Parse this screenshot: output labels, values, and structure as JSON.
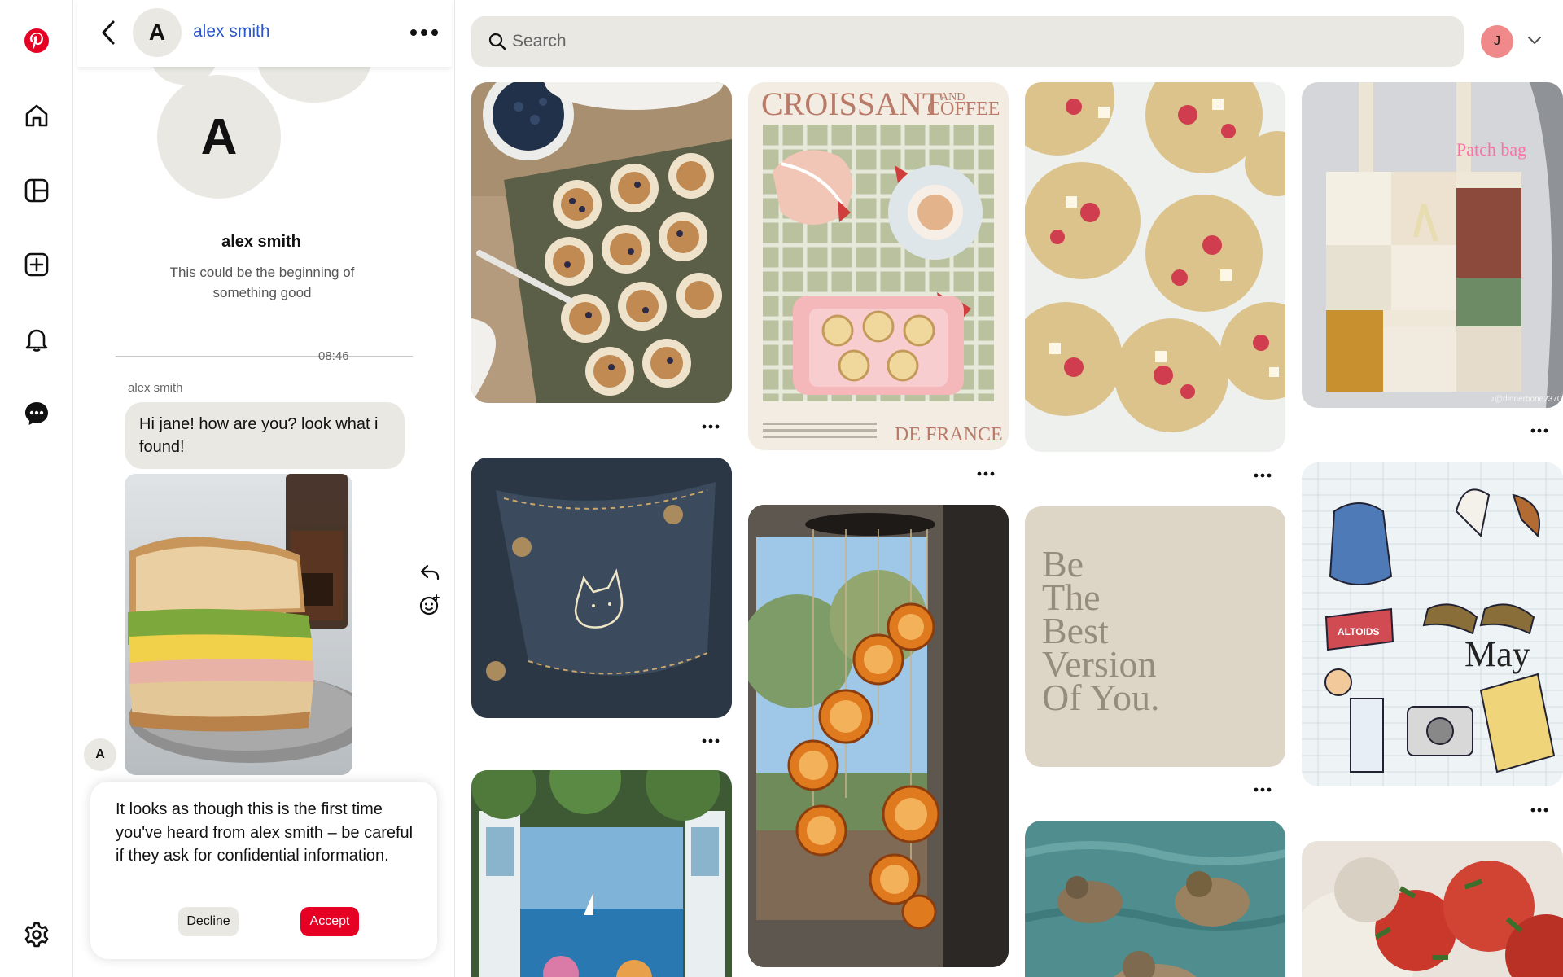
{
  "rail": {
    "items": [
      {
        "icon": "pinterest-logo-icon"
      },
      {
        "icon": "home-icon"
      },
      {
        "icon": "boards-icon"
      },
      {
        "icon": "create-icon"
      },
      {
        "icon": "notifications-icon"
      },
      {
        "icon": "messages-icon"
      },
      {
        "icon": "settings-icon"
      }
    ],
    "brand_color": "#e60023"
  },
  "conversation": {
    "header": {
      "avatar_letter": "A",
      "name": "alex smith"
    },
    "profile": {
      "avatar_letter": "A",
      "name": "alex smith",
      "subtitle": "This could be the beginning of something good"
    },
    "timestamp": "08:46",
    "messages": [
      {
        "sender": "alex smith",
        "text": "Hi jane! how are you? look what i found!",
        "image": "sandwich-photo",
        "avatar_letter": "A"
      }
    ],
    "notice": {
      "text": "It looks as though this is the first time you've heard from alex smith – be careful if they ask for confidential information.",
      "decline_label": "Decline",
      "accept_label": "Accept"
    }
  },
  "search": {
    "placeholder": "Search",
    "value": ""
  },
  "account": {
    "avatar_letter": "J",
    "avatar_color": "#f08a8a"
  },
  "pins": [
    {
      "image": "blueberry-muffins"
    },
    {
      "image": "croissant-and-coffee-poster",
      "text_top": "CROISSANT",
      "text_and": "AND",
      "text_coffee": "COFFEE",
      "text_bottom": "DE FRANCE"
    },
    {
      "image": "raspberry-cookies"
    },
    {
      "image": "patch-bag",
      "label": "Patch bag",
      "credit": "♪@dinnerbone2370"
    },
    {
      "image": "jeans-pocket-cat"
    },
    {
      "image": "dried-orange-wind-chime"
    },
    {
      "image": "be-the-best-version-quote",
      "quote": [
        "Be",
        "The",
        "Best",
        "Version",
        "Of You."
      ]
    },
    {
      "image": "may-journal-sketch",
      "label": "May",
      "tin_label": "ALTOIDS"
    },
    {
      "image": "window-sea-view"
    },
    {
      "image": "ducks-in-water"
    },
    {
      "image": "tomato-salad"
    }
  ]
}
